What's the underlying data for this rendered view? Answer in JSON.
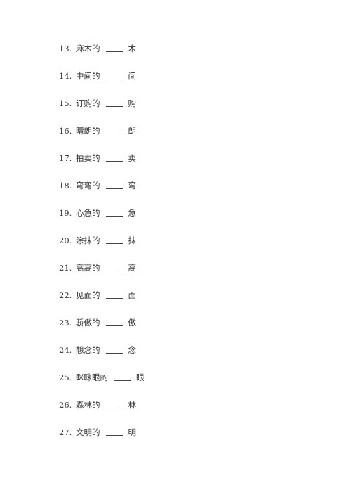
{
  "items": [
    {
      "number": "13.",
      "prefix": "麻木的",
      "suffix": "木"
    },
    {
      "number": "14.",
      "prefix": "中间的",
      "suffix": "间"
    },
    {
      "number": "15.",
      "prefix": "订购的",
      "suffix": "购"
    },
    {
      "number": "16.",
      "prefix": "晴朗的",
      "suffix": "朗"
    },
    {
      "number": "17.",
      "prefix": "拍卖的",
      "suffix": "卖"
    },
    {
      "number": "18.",
      "prefix": "弯弯的",
      "suffix": "弯"
    },
    {
      "number": "19.",
      "prefix": "心急的",
      "suffix": "急"
    },
    {
      "number": "20.",
      "prefix": "涂抹的",
      "suffix": "抹"
    },
    {
      "number": "21.",
      "prefix": "高高的",
      "suffix": "高"
    },
    {
      "number": "22.",
      "prefix": "见面的",
      "suffix": "面"
    },
    {
      "number": "23.",
      "prefix": "骄傲的",
      "suffix": "傲"
    },
    {
      "number": "24.",
      "prefix": "想念的",
      "suffix": "念"
    },
    {
      "number": "25.",
      "prefix": "眯眯眼的",
      "suffix": "眼"
    },
    {
      "number": "26.",
      "prefix": "森林的",
      "suffix": "林"
    },
    {
      "number": "27.",
      "prefix": "文明的",
      "suffix": "明"
    }
  ]
}
